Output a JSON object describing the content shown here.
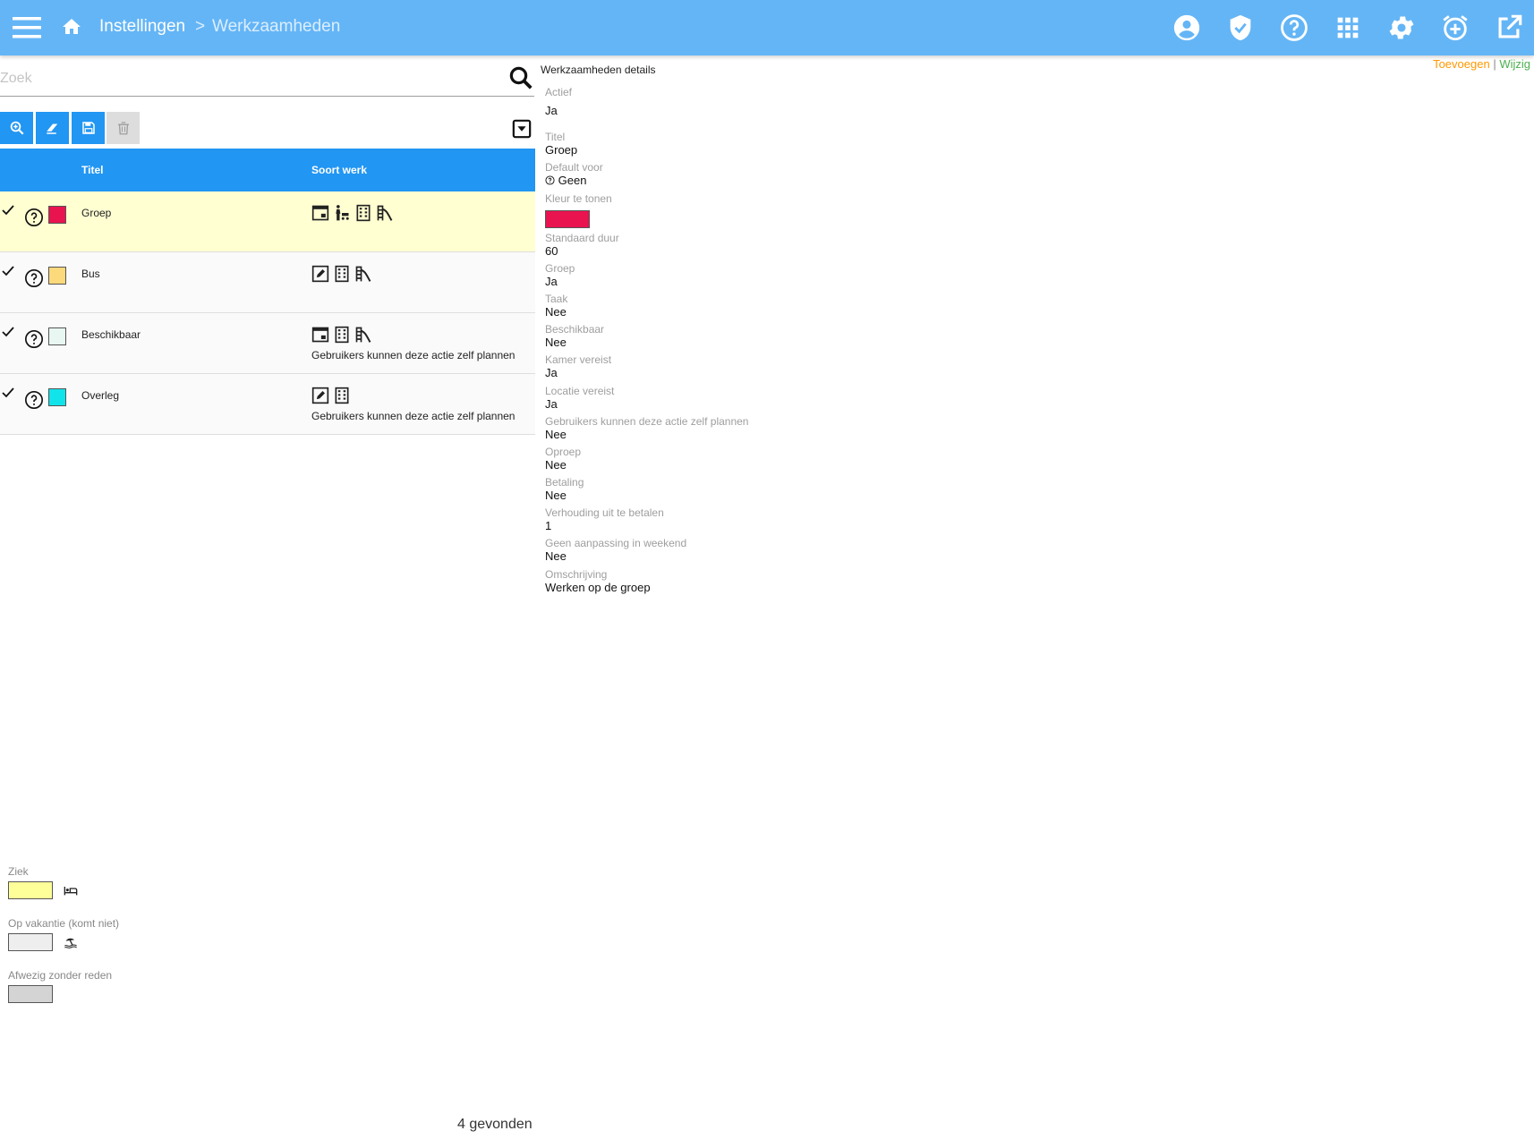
{
  "header": {
    "breadcrumb": [
      "Instellingen",
      "Werkzaamheden"
    ],
    "separator": ">",
    "bar_color": "#64b5f6",
    "icons": [
      "account-icon",
      "shield-check-icon",
      "help-icon",
      "apps-icon",
      "gear-icon",
      "alarm-add-icon",
      "open-external-icon"
    ]
  },
  "search": {
    "placeholder": "Zoek",
    "value": ""
  },
  "toolbar": {
    "buttons": [
      "zoom-in-icon",
      "eraser-icon",
      "save-icon",
      "delete-icon"
    ]
  },
  "table": {
    "columns": [
      "Titel",
      "Soort werk"
    ],
    "rows": [
      {
        "title": "Groep",
        "color": "#e8134f",
        "icons": [
          "calendar-window-icon",
          "person-stroller-icon",
          "building-icon",
          "playground-icon"
        ],
        "note": ""
      },
      {
        "title": "Bus",
        "color": "#fcd97b",
        "icons": [
          "edit-square-icon",
          "building-icon",
          "playground-icon"
        ],
        "note": ""
      },
      {
        "title": "Beschikbaar",
        "color": "#e8f7f2",
        "icons": [
          "calendar-window-icon",
          "building-icon",
          "playground-icon"
        ],
        "note": "Gebruikers kunnen deze actie zelf plannen"
      },
      {
        "title": "Overleg",
        "color": "#10e4ea",
        "icons": [
          "edit-square-icon",
          "building-icon"
        ],
        "note": "Gebruikers kunnen deze actie zelf plannen"
      }
    ]
  },
  "actions": {
    "add": "Toevoegen",
    "separator": "|",
    "edit": "Wijzig"
  },
  "details": {
    "title": "Werkzaamheden details",
    "fields": [
      {
        "label": "Actief",
        "value": "Ja"
      },
      {
        "label": "Titel",
        "value": "Groep"
      },
      {
        "label": "Default voor",
        "value": "Geen"
      },
      {
        "label": "Kleur te tonen",
        "value": "#e8134f"
      },
      {
        "label": "Standaard duur",
        "value": "60"
      },
      {
        "label": "Groep",
        "value": "Ja"
      },
      {
        "label": "Taak",
        "value": "Nee"
      },
      {
        "label": "Beschikbaar",
        "value": "Nee"
      },
      {
        "label": "Kamer vereist",
        "value": "Ja"
      },
      {
        "label": "Locatie vereist",
        "value": "Ja"
      },
      {
        "label": "Gebruikers kunnen deze actie zelf plannen",
        "value": "Nee"
      },
      {
        "label": "Oproep",
        "value": "Nee"
      },
      {
        "label": "Betaling",
        "value": "Nee"
      },
      {
        "label": "Verhouding uit te betalen",
        "value": "1"
      },
      {
        "label": "Geen aanpassing in weekend",
        "value": "Nee"
      },
      {
        "label": "Omschrijving",
        "value": "Werken op de groep"
      }
    ]
  },
  "legend": [
    {
      "label": "Ziek",
      "color": "#ffff99",
      "icon": "bed-icon"
    },
    {
      "label": "Op vakantie (komt niet)",
      "color": "#eeeeee",
      "icon": "beach-icon"
    },
    {
      "label": "Afwezig zonder reden",
      "color": "#d4d4d4",
      "icon": ""
    }
  ],
  "footer": {
    "found": "4 gevonden"
  }
}
